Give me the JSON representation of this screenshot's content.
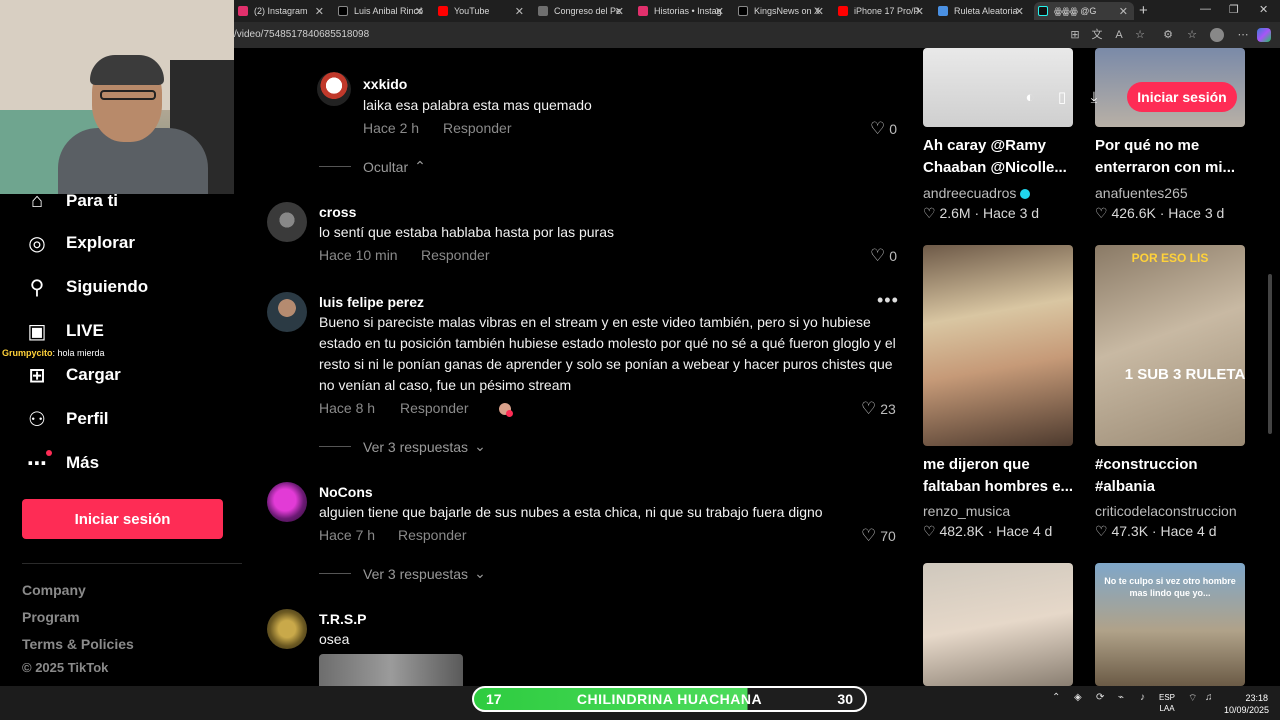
{
  "browser": {
    "tabs": [
      {
        "title": "(2) Instagram",
        "color": "#e1306c"
      },
      {
        "title": "Luis Anibal Rincó",
        "color": "#000000"
      },
      {
        "title": "YouTube",
        "color": "#ff0000"
      },
      {
        "title": "Congreso del Pe",
        "color": "#6f6f6f"
      },
      {
        "title": "Historias • Instag",
        "color": "#e1306c"
      },
      {
        "title": "KingsNews on X",
        "color": "#000000"
      },
      {
        "title": "iPhone 17 Pro/P",
        "color": "#ff0000"
      },
      {
        "title": "Ruleta Aleatoria",
        "color": "#4a90e2"
      },
      {
        "title": "ꙮꙮꙮ @G",
        "color": "#111111"
      }
    ],
    "url": "/video/7548517840685518098"
  },
  "sidebar": {
    "items": [
      {
        "label": "Para ti",
        "icon": "home-icon"
      },
      {
        "label": "Explorar",
        "icon": "compass-icon"
      },
      {
        "label": "Siguiendo",
        "icon": "following-icon"
      },
      {
        "label": "LIVE",
        "icon": "live-icon"
      },
      {
        "label": "Cargar",
        "icon": "upload-icon"
      },
      {
        "label": "Perfil",
        "icon": "profile-icon"
      },
      {
        "label": "Más",
        "icon": "more-icon"
      }
    ],
    "login_label": "Iniciar sesión",
    "footer": [
      "Company",
      "Program",
      "Terms & Policies",
      "© 2025 TikTok"
    ]
  },
  "stream_chat": {
    "user": "Grumpycito",
    "message": ": hola mierda"
  },
  "comments": [
    {
      "user": "xxkido",
      "text": "laika esa palabra esta mas quemado",
      "time": "Hace 2 h",
      "reply": "Responder",
      "likes": "0"
    },
    {
      "more_label": "Ocultar"
    },
    {
      "user": "cross",
      "text": "lo sentí que estaba hablaba hasta por las puras",
      "time": "Hace 10 min",
      "reply": "Responder",
      "likes": "0"
    },
    {
      "user": "luis felipe perez",
      "text": "Bueno si pareciste malas vibras en el stream y en este video también, pero si yo hubiese estado en tu posición también hubiese estado molesto por qué no sé a qué fueron gloglo y el resto si ni le ponían ganas de aprender y solo se ponían a webear y hacer puros chistes que no venían al caso, fue un pésimo stream",
      "time": "Hace 8 h",
      "reply": "Responder",
      "likes": "23",
      "more_label": "Ver 3 respuestas"
    },
    {
      "user": "NoCons",
      "text": "alguien tiene que bajarle de sus nubes a esta chica, ni que su trabajo fuera digno",
      "time": "Hace 7 h",
      "reply": "Responder",
      "likes": "70",
      "more_label": "Ver 3 respuestas"
    },
    {
      "user": "T.R.S.P",
      "text": "osea"
    }
  ],
  "right": {
    "login_label": "Iniciar sesión",
    "videos": [
      {
        "title": "Ah caray @Ramy Chaaban @Nicolle...",
        "author": "andreecuadros",
        "verified": true,
        "stats": "2.6M · Hace 3 d"
      },
      {
        "title": "Por qué no me enterraron con mi...",
        "author": "anafuentes265",
        "stats": "426.6K · Hace 3 d"
      },
      {
        "title": "me dijeron que faltaban hombres e...",
        "author": "renzo_musica",
        "stats": "482.8K · Hace 4 d"
      },
      {
        "title": "#construccion #albania",
        "author": "criticodelaconstruccion",
        "stats": "47.3K · Hace 4 d",
        "caption_top": "POR ESO LIS",
        "caption_mid": "1 SUB 3 RULETAS"
      },
      {
        "caption": "No te culpo si vez otro hombre mas lindo que yo..."
      }
    ]
  },
  "overlay": {
    "left": "17",
    "name": "CHILINDRINA HUACHANA",
    "right": "30"
  },
  "system": {
    "lang1": "ESP",
    "lang2": "LAA",
    "time": "23:18",
    "date": "10/09/2025"
  }
}
